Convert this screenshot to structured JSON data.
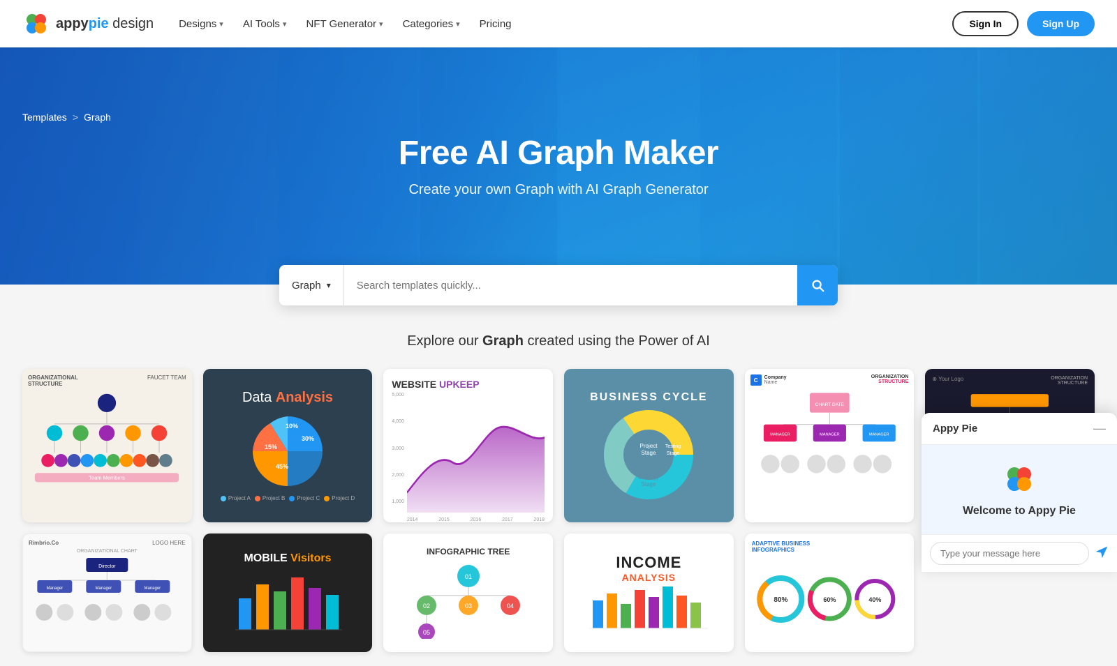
{
  "brand": {
    "name": "appypie design",
    "logo_text": "appy",
    "logo_highlight": "pie"
  },
  "nav": {
    "links": [
      {
        "label": "Designs",
        "has_dropdown": true
      },
      {
        "label": "AI Tools",
        "has_dropdown": true
      },
      {
        "label": "NFT Generator",
        "has_dropdown": true
      },
      {
        "label": "Categories",
        "has_dropdown": true
      },
      {
        "label": "Pricing",
        "has_dropdown": false
      }
    ],
    "signin": "Sign In",
    "signup": "Sign Up"
  },
  "breadcrumb": {
    "parent": "Templates",
    "separator": ">",
    "current": "Graph"
  },
  "hero": {
    "title": "Free AI Graph Maker",
    "subtitle": "Create your own Graph with AI Graph Generator"
  },
  "search": {
    "type_label": "Graph",
    "placeholder": "Search templates quickly..."
  },
  "explore": {
    "prefix": "Explore our ",
    "highlight": "Graph",
    "suffix": " created using the Power of AI"
  },
  "cards": [
    {
      "id": "org-structure",
      "title": "ORGANIZATIONAL STRUCTURE",
      "subtitle": "FAUCET TEAM",
      "bg": "org",
      "type": "org-chart"
    },
    {
      "id": "data-analysis",
      "title": "Data",
      "title_highlight": "Analysis",
      "bg": "dark",
      "type": "pie-chart",
      "segments": [
        {
          "label": "Project A",
          "value": 10,
          "color": "#4FC3F7"
        },
        {
          "label": "Project B",
          "value": 15,
          "color": "#FF7043"
        },
        {
          "label": "Project C",
          "value": 30,
          "color": "#2196F3"
        },
        {
          "label": "Project D",
          "value": 45,
          "color": "#FF9800"
        }
      ]
    },
    {
      "id": "website-upkeep",
      "title": "WEBSITE",
      "title_highlight": "UPKEEP",
      "bg": "white",
      "type": "area-chart"
    },
    {
      "id": "business-cycle",
      "title": "BUSINESS CYCLE",
      "bg": "blue-gray",
      "type": "donut-chart",
      "segments": [
        {
          "label": "Project Stage",
          "color": "#26C6DA"
        },
        {
          "label": "Testing Stage",
          "color": "#80CBC4"
        },
        {
          "label": "Strategy Stage",
          "color": "#FDD835"
        }
      ]
    },
    {
      "id": "org-structure-2",
      "title": "ORGANIZATION STRUCTURE",
      "bg": "white",
      "type": "org-chart-2"
    },
    {
      "id": "org-structure-3",
      "title": "ORGANIZATION STRUCTURE",
      "bg": "dark",
      "type": "org-chart-3"
    },
    {
      "id": "rimbrio",
      "title": "Rimbrio.Co",
      "subtitle": "LOGO HERE",
      "bg": "light",
      "type": "org-chart"
    },
    {
      "id": "mobile-visitors",
      "title": "MOBILE",
      "title_highlight": "Visitors",
      "bg": "dark",
      "type": "bar-chart"
    },
    {
      "id": "infographic-tree",
      "title": "INFOGRAPHIC TREE",
      "bg": "white",
      "type": "tree"
    },
    {
      "id": "income-analysis",
      "title": "INCOME",
      "title_highlight": "ANALYSIS",
      "bg": "white",
      "type": "bar-chart"
    },
    {
      "id": "adaptive-infographics",
      "title": "ADAPTIVE BUSINESS INFOGRAPHICS",
      "bg": "white",
      "type": "infographic"
    }
  ],
  "chat": {
    "header_title": "Appy Pie",
    "welcome_text": "Welcome to Appy Pie",
    "input_placeholder": "Type your message here",
    "close_label": "—"
  }
}
